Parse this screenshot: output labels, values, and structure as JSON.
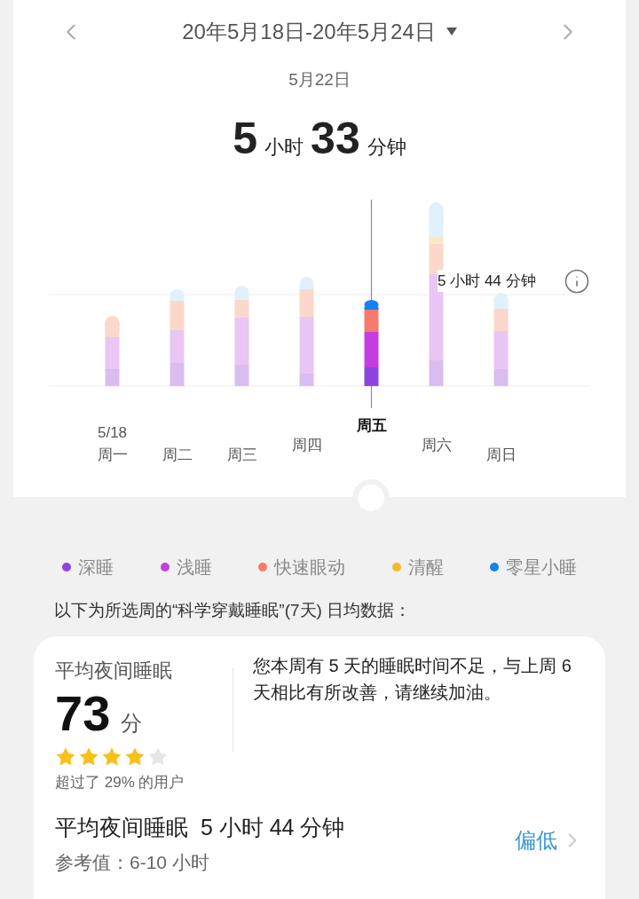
{
  "header": {
    "range": "20年5月18日-20年5月24日",
    "selected_date": "5月22日"
  },
  "total": {
    "hours": "5",
    "hours_unit": "小时",
    "minutes": "33",
    "minutes_unit": "分钟"
  },
  "chart": {
    "reference_label": "5 小时 44 分钟",
    "days": [
      {
        "date": "5/18",
        "label": "周一",
        "selected": false
      },
      {
        "label": "周二",
        "selected": false
      },
      {
        "label": "周三",
        "selected": false
      },
      {
        "label": "周四",
        "selected": false
      },
      {
        "label": "周五",
        "selected": true
      },
      {
        "label": "周六",
        "selected": false
      },
      {
        "label": "周日",
        "selected": false
      }
    ]
  },
  "legend": [
    {
      "label": "深睡",
      "color": "#8e44e0"
    },
    {
      "label": "浅睡",
      "color": "#c53de0"
    },
    {
      "label": "快速眼动",
      "color": "#f77a70"
    },
    {
      "label": "清醒",
      "color": "#f7b928"
    },
    {
      "label": "零星小睡",
      "color": "#1283f0"
    }
  ],
  "caption": "以下为所选周的“科学穿戴睡眠”(7天) 日均数据：",
  "summary": {
    "score_title": "平均夜间睡眠",
    "score": "73",
    "score_unit": "分",
    "stars": 4,
    "percentile": "超过了 29% 的用户",
    "message": "您本周有 5 天的睡眠时间不足，与上周 6 天相比有所改善，请继续加油。",
    "avg_label": "平均夜间睡眠",
    "avg_value": "5 小时 44 分钟",
    "reference": "参考值：6-10 小时",
    "status": "偏低"
  }
}
